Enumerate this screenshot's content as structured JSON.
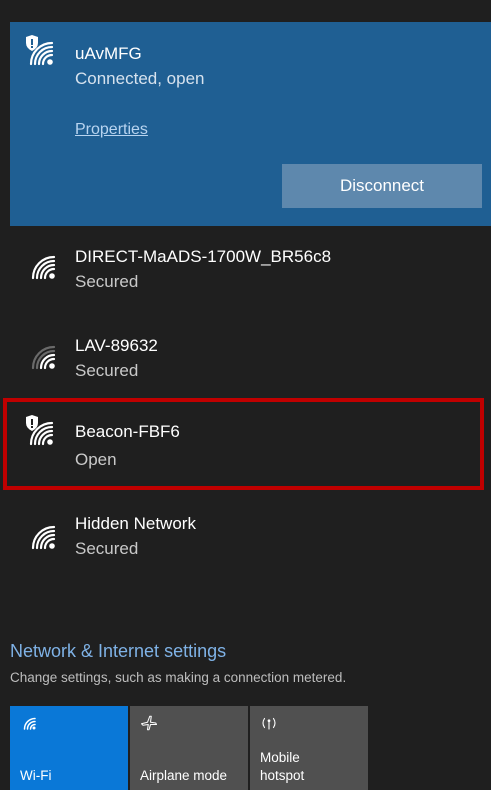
{
  "connected_network": {
    "name": "uAvMFG",
    "status": "Connected, open",
    "properties_label": "Properties",
    "disconnect_label": "Disconnect",
    "icon": "wifi-shield-icon"
  },
  "networks": [
    {
      "name": "DIRECT-MaADS-1700W_BR56c8",
      "status": "Secured",
      "icon": "wifi-icon"
    },
    {
      "name": "LAV-89632",
      "status": "Secured",
      "icon": "wifi-weak-icon"
    },
    {
      "name": "Beacon-FBF6",
      "status": "Open",
      "icon": "wifi-shield-icon",
      "highlighted": true
    },
    {
      "name": "Hidden Network",
      "status": "Secured",
      "icon": "wifi-icon"
    }
  ],
  "settings": {
    "title": "Network & Internet settings",
    "subtitle": "Change settings, such as making a connection metered."
  },
  "quick_actions": [
    {
      "label": "Wi-Fi",
      "icon": "wifi-icon",
      "active": true
    },
    {
      "label": "Airplane mode",
      "icon": "airplane-icon",
      "active": false
    },
    {
      "label_line1": "Mobile",
      "label_line2": "hotspot",
      "icon": "hotspot-icon",
      "active": false
    }
  ],
  "colors": {
    "connected_bg": "#1f5f93",
    "panel_bg": "#1f1f1f",
    "accent": "#0a78d7",
    "link": "#7fb2e6",
    "highlight_border": "#c00000"
  }
}
